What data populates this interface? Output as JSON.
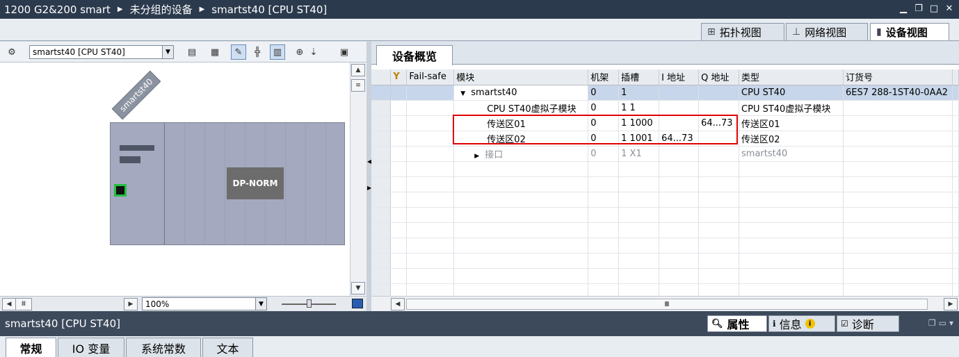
{
  "title": {
    "project": "1200 G2&200 smart",
    "group": "未分组的设备",
    "device": "smartst40 [CPU ST40]"
  },
  "view_tabs": [
    {
      "label": "拓扑视图",
      "icon": "topology-view-icon"
    },
    {
      "label": "网络视图",
      "icon": "network-view-icon"
    },
    {
      "label": "设备视图",
      "icon": "device-view-icon"
    }
  ],
  "left_toolbar": {
    "device_select": "smartst40 [CPU ST40]",
    "zoom": "100%"
  },
  "canvas": {
    "device_label": "smartst40",
    "module_label": "DP-NORM"
  },
  "overview": {
    "tab_label": "设备概览",
    "columns": [
      "",
      "Fail-safe",
      "模块",
      "机架",
      "插槽",
      "I 地址",
      "Q 地址",
      "类型",
      "订货号"
    ],
    "rows": [
      {
        "module": "smartst40",
        "rack": "0",
        "slot": "1",
        "i_addr": "",
        "q_addr": "",
        "type": "CPU ST40",
        "order": "6ES7 288-1ST40-0AA2"
      },
      {
        "module": "CPU ST40虚拟子模块",
        "rack": "0",
        "slot": "1 1",
        "i_addr": "",
        "q_addr": "",
        "type": "CPU ST40虚拟子模块",
        "order": ""
      },
      {
        "module": "传送区01",
        "rack": "0",
        "slot": "1 1000",
        "i_addr": "",
        "q_addr": "64...73",
        "type": "传送区01",
        "order": ""
      },
      {
        "module": "传送区02",
        "rack": "0",
        "slot": "1 1001",
        "i_addr": "64...73",
        "q_addr": "",
        "type": "传送区02",
        "order": ""
      },
      {
        "module": "接口",
        "rack": "0",
        "slot": "1 X1",
        "i_addr": "",
        "q_addr": "",
        "type": "smartst40",
        "order": ""
      }
    ]
  },
  "status": {
    "selection": "smartst40 [CPU ST40]",
    "properties": "属性",
    "info": "信息",
    "diagnostics": "诊断"
  },
  "bottom_tabs": [
    "常规",
    "IO 变量",
    "系统常数",
    "文本"
  ]
}
